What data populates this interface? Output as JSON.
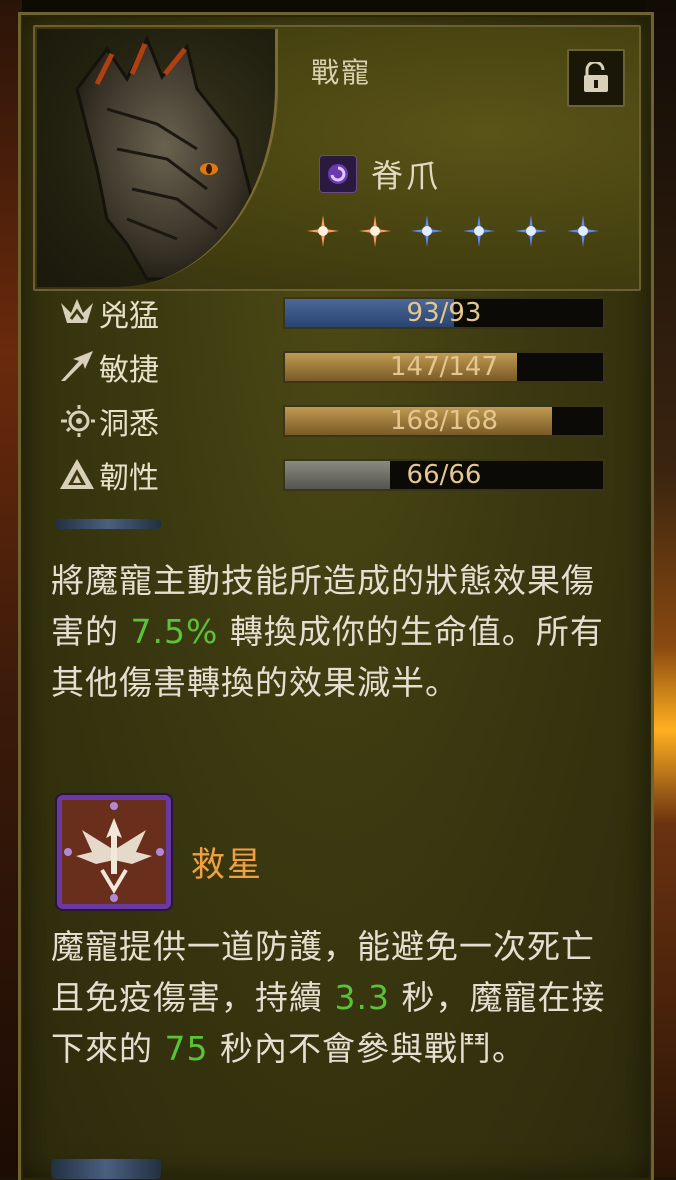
{
  "pet": {
    "type_label": "戰寵",
    "name": "脊爪",
    "lock_icon": "unlock-icon",
    "rune_icon": "void-rune-icon",
    "stars": [
      {
        "color": "orange"
      },
      {
        "color": "orange"
      },
      {
        "color": "blue"
      },
      {
        "color": "blue"
      },
      {
        "color": "blue"
      },
      {
        "color": "blue"
      }
    ]
  },
  "stats": [
    {
      "icon": "ferocity-icon",
      "label": "兇猛",
      "value": "93/93",
      "fill_fraction": 0.53,
      "color": "blue"
    },
    {
      "icon": "agility-icon",
      "label": "敏捷",
      "value": "147/147",
      "fill_fraction": 0.73,
      "color": "gold"
    },
    {
      "icon": "insight-icon",
      "label": "洞悉",
      "value": "168/168",
      "fill_fraction": 0.84,
      "color": "gold"
    },
    {
      "icon": "toughness-icon",
      "label": "韌性",
      "value": "66/66",
      "fill_fraction": 0.33,
      "color": "grey"
    }
  ],
  "passive": {
    "pre": "將魔寵主動技能所造成的狀態效果傷害的 ",
    "value": "7.5%",
    "post": " 轉換成你的生命值。所有其他傷害轉換的效果減半。"
  },
  "skill": {
    "icon": "ward-star-icon",
    "name": "救星",
    "desc_pre": "魔寵提供一道防護，能避免一次死亡且免疫傷害，持續 ",
    "duration": "3.3",
    "desc_mid": " 秒，魔寵在接下來的 ",
    "cooldown": "75",
    "desc_post": " 秒內不會參與戰鬥。"
  },
  "colors": {
    "highlight": "#5cc23a",
    "skill_name": "#f0a040",
    "bar_text": "#e4c68e"
  }
}
